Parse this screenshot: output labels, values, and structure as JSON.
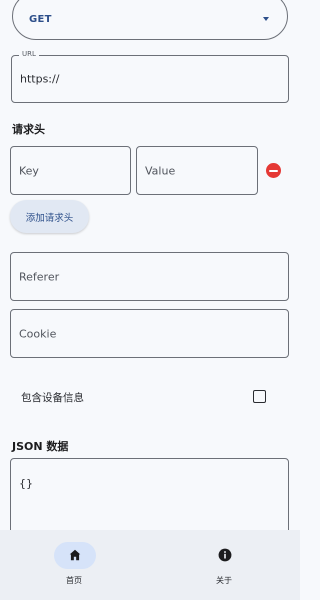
{
  "request": {
    "method": "GET",
    "url_label": "URL",
    "url_value": "https://"
  },
  "headers": {
    "title": "请求头",
    "key_placeholder": "Key",
    "value_placeholder": "Value",
    "add_label": "添加请求头"
  },
  "referer_placeholder": "Referer",
  "cookie_placeholder": "Cookie",
  "device_info": {
    "label": "包含设备信息",
    "checked": false
  },
  "json_section": {
    "title": "JSON 数据",
    "value": "{}"
  },
  "nav": {
    "home_label": "首页",
    "about_label": "关于",
    "home_icon": "home-icon",
    "about_icon": "info-icon"
  },
  "colors": {
    "accent": "#2d4f8a",
    "danger": "#e53935",
    "nav_active": "#d6e3f9"
  }
}
